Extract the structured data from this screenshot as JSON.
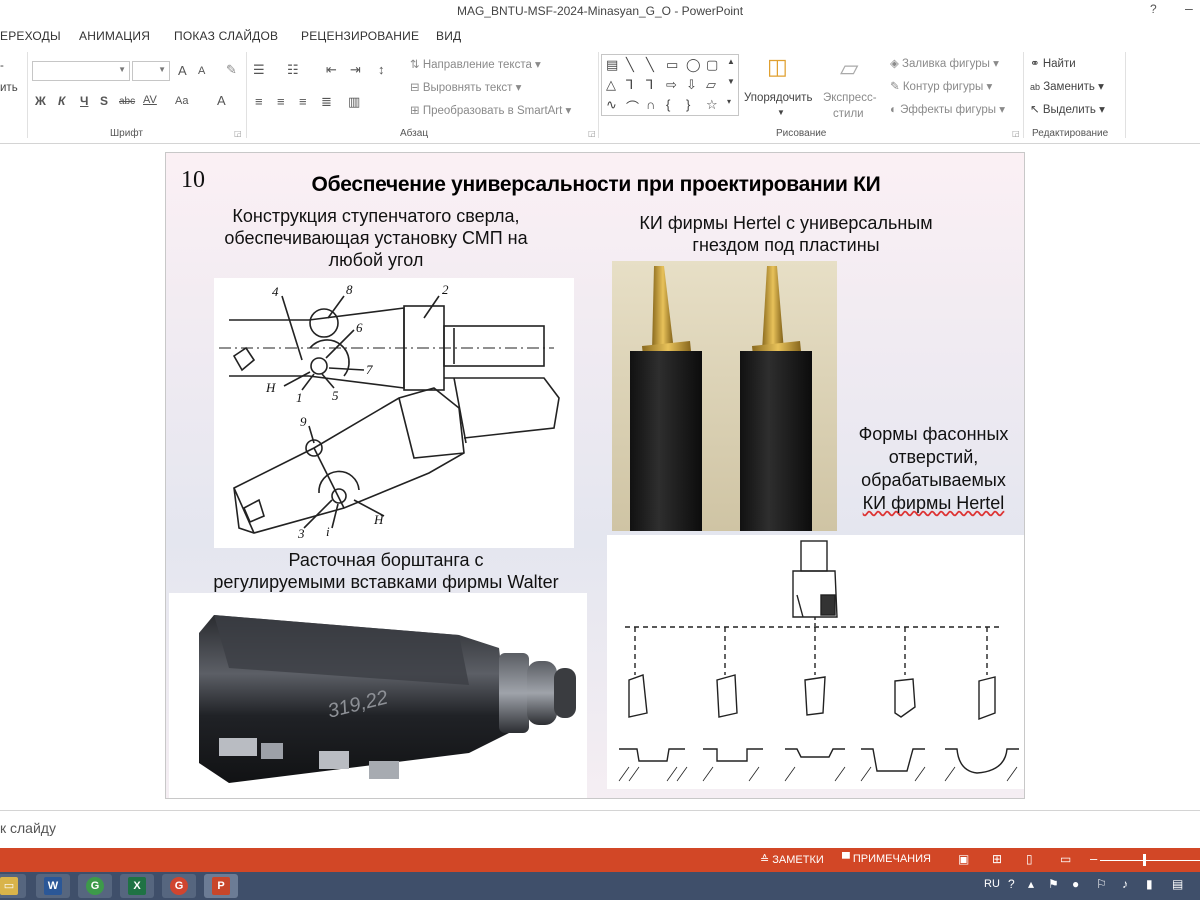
{
  "window": {
    "title": "MAG_BNTU-MSF-2024-Minasyan_G_O - PowerPoint",
    "help": "?",
    "minimize": "–"
  },
  "tabs": [
    "ЕРЕХОДЫ",
    "АНИМАЦИЯ",
    "ПОКАЗ СЛАЙДОВ",
    "РЕЦЕНЗИРОВАНИЕ",
    "ВИД"
  ],
  "ribbon": {
    "clipboard": {
      "partial1": "ить",
      "partial2": "-"
    },
    "font": {
      "label": "Шрифт",
      "bold": "Ж",
      "italic": "К",
      "underline": "Ч",
      "strike": "S",
      "shadow": "abc",
      "spacing": "AV",
      "case": "Aa",
      "color": "A",
      "grow": "A",
      "shrink": "A"
    },
    "paragraph": {
      "label": "Абзац",
      "text_direction": "Направление текста",
      "align_text": "Выровнять текст",
      "smartart": "Преобразовать в SmartArt"
    },
    "drawing": {
      "label": "Рисование",
      "arrange": "Упорядочить",
      "quick_styles_1": "Экспресс-",
      "quick_styles_2": "стили",
      "fill": "Заливка фигуры",
      "outline": "Контур фигуры",
      "effects": "Эффекты фигуры"
    },
    "editing": {
      "label": "Редактирование",
      "find": "Найти",
      "replace": "Заменить",
      "select": "Выделить"
    }
  },
  "slide": {
    "number": "10",
    "title": "Обеспечение универсальности при проектировании КИ",
    "caption_drill": [
      "Конструкция ступенчатого сверла,",
      "обеспечивающая установку СМП на",
      "любой угол"
    ],
    "caption_hertel": [
      "КИ фирмы Hertel с универсальным",
      "гнездом под пластины"
    ],
    "caption_shapes": [
      "Формы фасонных",
      "отверстий,",
      "обрабатываемых",
      "КИ фирмы Hertel"
    ],
    "caption_walter": [
      "Расточная борштанга с",
      "регулируемыми вставками фирмы Walter"
    ],
    "drawing_labels": [
      "4",
      "8",
      "2",
      "6",
      "7",
      "5",
      "1",
      "H",
      "9",
      "3",
      "i",
      "H"
    ],
    "bar_engraving": "319,22"
  },
  "notes": {
    "placeholder": "к слайду"
  },
  "statusbar": {
    "notes": "ЗАМЕТКИ",
    "comments": "ПРИМЕЧАНИЯ",
    "zoom_minus": "–",
    "zoom_plus": "+"
  },
  "taskbar": {
    "apps": [
      {
        "name": "explorer",
        "glyph": "▭",
        "color": "#d9b44a"
      },
      {
        "name": "word",
        "glyph": "W",
        "color": "#2b5797"
      },
      {
        "name": "chrome",
        "glyph": "G",
        "color": "#3d9a4a"
      },
      {
        "name": "excel",
        "glyph": "X",
        "color": "#1f7244"
      },
      {
        "name": "chrome2",
        "glyph": "G",
        "color": "#d0452f"
      },
      {
        "name": "powerpoint",
        "glyph": "P",
        "color": "#c8462a"
      }
    ],
    "lang": "RU"
  }
}
